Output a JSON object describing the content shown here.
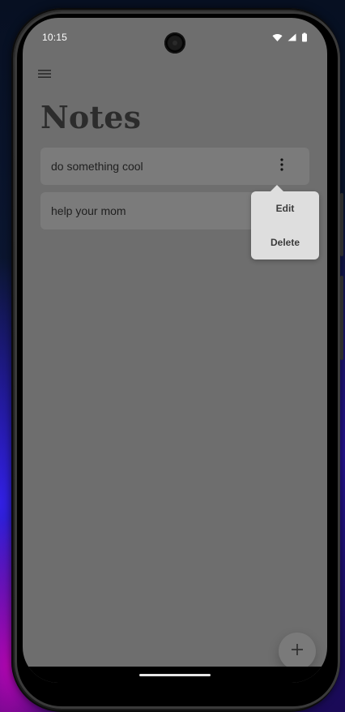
{
  "status_bar": {
    "time": "10:15",
    "icons": [
      "wifi-icon",
      "signal-icon",
      "battery-icon"
    ]
  },
  "app_bar": {
    "menu_icon": "menu-icon"
  },
  "page": {
    "title": "Notes"
  },
  "notes": [
    {
      "text": "do something cool",
      "has_kebab_visible": true
    },
    {
      "text": "help your mom",
      "has_kebab_visible": false
    }
  ],
  "context_menu": {
    "items": [
      {
        "label": "Edit"
      },
      {
        "label": "Delete"
      }
    ]
  },
  "fab": {
    "icon": "plus-icon"
  },
  "colors": {
    "screen_background": "#6e6e6e",
    "card_background": "#7b7b7b",
    "title_color": "#2c2c2c",
    "menu_background": "#dedede"
  }
}
